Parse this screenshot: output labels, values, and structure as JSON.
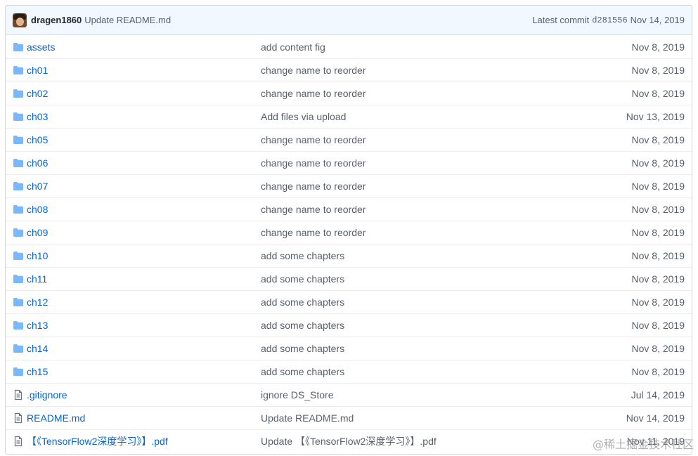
{
  "latest_commit": {
    "author": "dragen1860",
    "message": "Update README.md",
    "label": "Latest commit",
    "sha": "d281556",
    "date": "Nov 14, 2019"
  },
  "files": [
    {
      "name": "assets",
      "type": "dir",
      "message": "add content fig",
      "date": "Nov 8, 2019"
    },
    {
      "name": "ch01",
      "type": "dir",
      "message": "change name to reorder",
      "date": "Nov 8, 2019"
    },
    {
      "name": "ch02",
      "type": "dir",
      "message": "change name to reorder",
      "date": "Nov 8, 2019"
    },
    {
      "name": "ch03",
      "type": "dir",
      "message": "Add files via upload",
      "date": "Nov 13, 2019"
    },
    {
      "name": "ch05",
      "type": "dir",
      "message": "change name to reorder",
      "date": "Nov 8, 2019"
    },
    {
      "name": "ch06",
      "type": "dir",
      "message": "change name to reorder",
      "date": "Nov 8, 2019"
    },
    {
      "name": "ch07",
      "type": "dir",
      "message": "change name to reorder",
      "date": "Nov 8, 2019"
    },
    {
      "name": "ch08",
      "type": "dir",
      "message": "change name to reorder",
      "date": "Nov 8, 2019"
    },
    {
      "name": "ch09",
      "type": "dir",
      "message": "change name to reorder",
      "date": "Nov 8, 2019"
    },
    {
      "name": "ch10",
      "type": "dir",
      "message": "add some chapters",
      "date": "Nov 8, 2019"
    },
    {
      "name": "ch11",
      "type": "dir",
      "message": "add some chapters",
      "date": "Nov 8, 2019"
    },
    {
      "name": "ch12",
      "type": "dir",
      "message": "add some chapters",
      "date": "Nov 8, 2019"
    },
    {
      "name": "ch13",
      "type": "dir",
      "message": "add some chapters",
      "date": "Nov 8, 2019"
    },
    {
      "name": "ch14",
      "type": "dir",
      "message": "add some chapters",
      "date": "Nov 8, 2019"
    },
    {
      "name": "ch15",
      "type": "dir",
      "message": "add some chapters",
      "date": "Nov 8, 2019"
    },
    {
      "name": ".gitignore",
      "type": "file",
      "message": "ignore DS_Store",
      "date": "Jul 14, 2019"
    },
    {
      "name": "README.md",
      "type": "file",
      "message": "Update README.md",
      "date": "Nov 14, 2019"
    },
    {
      "name": "【《TensorFlow2深度学习》】.pdf",
      "type": "file",
      "message": "Update 【《TensorFlow2深度学习》】.pdf",
      "date": "Nov 11, 2019"
    }
  ],
  "watermark": "@稀土掘金技术社区",
  "colors": {
    "folder": "#79b8ff",
    "link": "#0366d6",
    "header_bg": "#f1f8ff"
  },
  "icons": {
    "dir": "folder-icon",
    "file": "file-icon"
  }
}
